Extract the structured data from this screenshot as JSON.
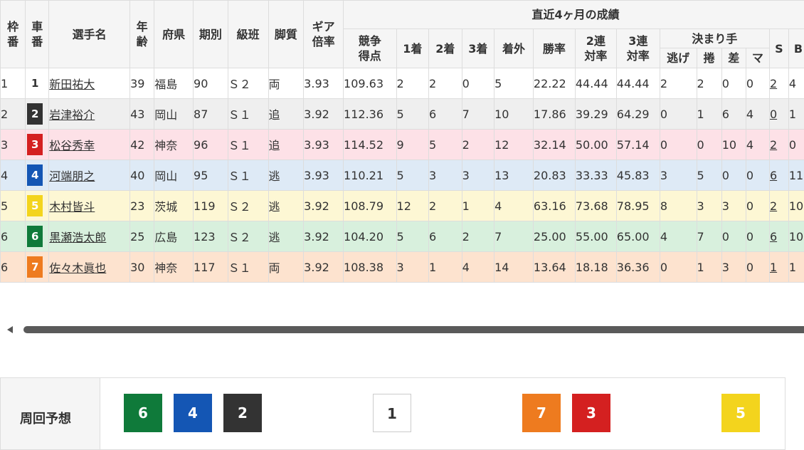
{
  "header": {
    "waku": [
      "枠",
      "番"
    ],
    "sha": [
      "車",
      "番"
    ],
    "name": "選手名",
    "age": [
      "年",
      "齢"
    ],
    "pref": "府県",
    "term": "期別",
    "grade": "級班",
    "leg": "脚質",
    "gear": [
      "ギア",
      "倍率"
    ],
    "group_recent": "直近4ヶ月の成績",
    "score": [
      "競争",
      "得点"
    ],
    "first": "1着",
    "second": "2着",
    "third": "3着",
    "out": "着外",
    "win_rate": "勝率",
    "rate2": [
      "2連",
      "対率"
    ],
    "rate3": [
      "3連",
      "対率"
    ],
    "group_kimarite": "決まり手",
    "nige": "逃げ",
    "makuri": "捲",
    "sashi": "差",
    "ma": "マ",
    "s": "S",
    "b": "B"
  },
  "rows": [
    {
      "waku": "1",
      "car": "1",
      "car_bg": "#ffffff",
      "car_fg": "#333333",
      "name": "新田祐大",
      "age": "39",
      "pref": "福島",
      "term": "90",
      "grade": "Ｓ２",
      "leg": "両",
      "gear": "3.93",
      "score": "109.63",
      "first": "2",
      "second": "2",
      "third": "0",
      "out": "5",
      "win_rate": "22.22",
      "rate2": "44.44",
      "rate3": "44.44",
      "nige": "2",
      "makuri": "2",
      "sashi": "0",
      "ma": "0",
      "s": "2",
      "b": "4",
      "row_bg": "#ffffff"
    },
    {
      "waku": "2",
      "car": "2",
      "car_bg": "#333333",
      "car_fg": "#ffffff",
      "name": "岩津裕介",
      "age": "43",
      "pref": "岡山",
      "term": "87",
      "grade": "Ｓ１",
      "leg": "追",
      "gear": "3.92",
      "score": "112.36",
      "first": "5",
      "second": "6",
      "third": "7",
      "out": "10",
      "win_rate": "17.86",
      "rate2": "39.29",
      "rate3": "64.29",
      "nige": "0",
      "makuri": "1",
      "sashi": "6",
      "ma": "4",
      "s": "0",
      "b": "1",
      "row_bg": "#efefef"
    },
    {
      "waku": "3",
      "car": "3",
      "car_bg": "#d42020",
      "car_fg": "#ffffff",
      "name": "松谷秀幸",
      "age": "42",
      "pref": "神奈",
      "term": "96",
      "grade": "Ｓ１",
      "leg": "追",
      "gear": "3.93",
      "score": "114.52",
      "first": "9",
      "second": "5",
      "third": "2",
      "out": "12",
      "win_rate": "32.14",
      "rate2": "50.00",
      "rate3": "57.14",
      "nige": "0",
      "makuri": "0",
      "sashi": "10",
      "ma": "4",
      "s": "2",
      "b": "0",
      "row_bg": "#fde1e7"
    },
    {
      "waku": "4",
      "car": "4",
      "car_bg": "#1456b4",
      "car_fg": "#ffffff",
      "name": "河端朋之",
      "age": "40",
      "pref": "岡山",
      "term": "95",
      "grade": "Ｓ１",
      "leg": "逃",
      "gear": "3.93",
      "score": "110.21",
      "first": "5",
      "second": "3",
      "third": "3",
      "out": "13",
      "win_rate": "20.83",
      "rate2": "33.33",
      "rate3": "45.83",
      "nige": "3",
      "makuri": "5",
      "sashi": "0",
      "ma": "0",
      "s": "6",
      "b": "11",
      "row_bg": "#deeaf6"
    },
    {
      "waku": "5",
      "car": "5",
      "car_bg": "#f3d41d",
      "car_fg": "#ffffff",
      "name": "木村皆斗",
      "age": "23",
      "pref": "茨城",
      "term": "119",
      "grade": "Ｓ２",
      "leg": "逃",
      "gear": "3.92",
      "score": "108.79",
      "first": "12",
      "second": "2",
      "third": "1",
      "out": "4",
      "win_rate": "63.16",
      "rate2": "73.68",
      "rate3": "78.95",
      "nige": "8",
      "makuri": "3",
      "sashi": "3",
      "ma": "0",
      "s": "2",
      "b": "10",
      "row_bg": "#fdf7d4"
    },
    {
      "waku": "6",
      "car": "6",
      "car_bg": "#0f7a3a",
      "car_fg": "#ffffff",
      "name": "黒瀬浩太郎",
      "age": "25",
      "pref": "広島",
      "term": "123",
      "grade": "Ｓ２",
      "leg": "逃",
      "gear": "3.92",
      "score": "104.20",
      "first": "5",
      "second": "6",
      "third": "2",
      "out": "7",
      "win_rate": "25.00",
      "rate2": "55.00",
      "rate3": "65.00",
      "nige": "4",
      "makuri": "7",
      "sashi": "0",
      "ma": "0",
      "s": "6",
      "b": "10",
      "row_bg": "#d8f0dd"
    },
    {
      "waku": "6",
      "car": "7",
      "car_bg": "#ee7b1f",
      "car_fg": "#ffffff",
      "name": "佐々木眞也",
      "age": "30",
      "pref": "神奈",
      "term": "117",
      "grade": "Ｓ１",
      "leg": "両",
      "gear": "3.92",
      "score": "108.38",
      "first": "3",
      "second": "1",
      "third": "4",
      "out": "14",
      "win_rate": "13.64",
      "rate2": "18.18",
      "rate3": "36.36",
      "nige": "0",
      "makuri": "1",
      "sashi": "3",
      "ma": "0",
      "s": "1",
      "b": "1",
      "row_bg": "#fde3cf"
    }
  ],
  "prediction": {
    "label": "周回予想",
    "boxes": [
      {
        "num": "6",
        "bg": "#0f7a3a",
        "fg": "#ffffff"
      },
      {
        "num": "4",
        "bg": "#1456b4",
        "fg": "#ffffff"
      },
      {
        "num": "2",
        "bg": "#333333",
        "fg": "#ffffff"
      },
      {
        "num": "1",
        "bg": "#ffffff",
        "fg": "#333333"
      },
      {
        "num": "7",
        "bg": "#ee7b1f",
        "fg": "#ffffff"
      },
      {
        "num": "3",
        "bg": "#d42020",
        "fg": "#ffffff"
      },
      {
        "num": "5",
        "bg": "#f3d41d",
        "fg": "#ffffff"
      }
    ]
  },
  "scrollbar": {
    "icon": "chevron-left-icon"
  }
}
